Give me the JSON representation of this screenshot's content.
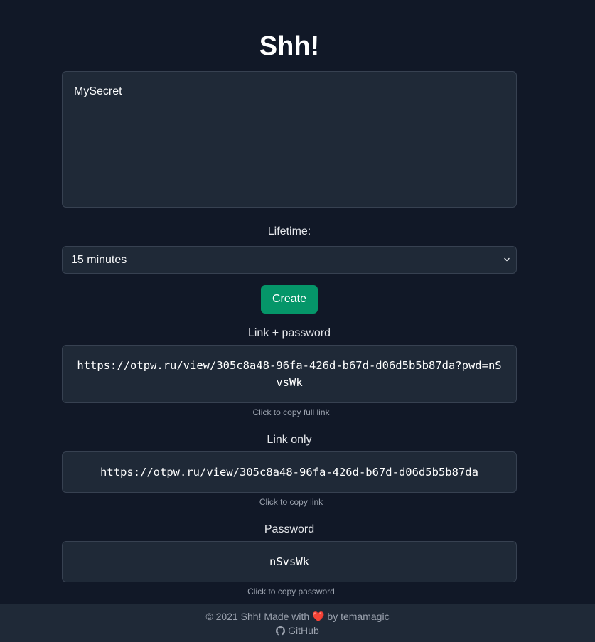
{
  "app": {
    "title": "Shh!"
  },
  "secret": {
    "value": "MySecret"
  },
  "lifetime": {
    "label": "Lifetime:",
    "selected": "15 minutes"
  },
  "create_button": {
    "label": "Create"
  },
  "results": {
    "full": {
      "heading": "Link + password",
      "value": "https://otpw.ru/view/305c8a48-96fa-426d-b67d-d06d5b5b87da?pwd=nSvsWk",
      "hint": "Click to copy full link"
    },
    "link": {
      "heading": "Link only",
      "value": "https://otpw.ru/view/305c8a48-96fa-426d-b67d-d06d5b5b87da",
      "hint": "Click to copy link"
    },
    "password": {
      "heading": "Password",
      "value": "nSvsWk",
      "hint": "Click to copy password"
    }
  },
  "footer": {
    "prefix": "© 2021 Shh! Made with",
    "heart": "❤️",
    "by": "by",
    "author": "temamagic",
    "github": "GitHub"
  },
  "colors": {
    "background": "#111827",
    "panel": "#1f2937",
    "accent": "#059669"
  },
  "icons": {
    "select": "chevron-down-icon",
    "github": "github-icon"
  }
}
